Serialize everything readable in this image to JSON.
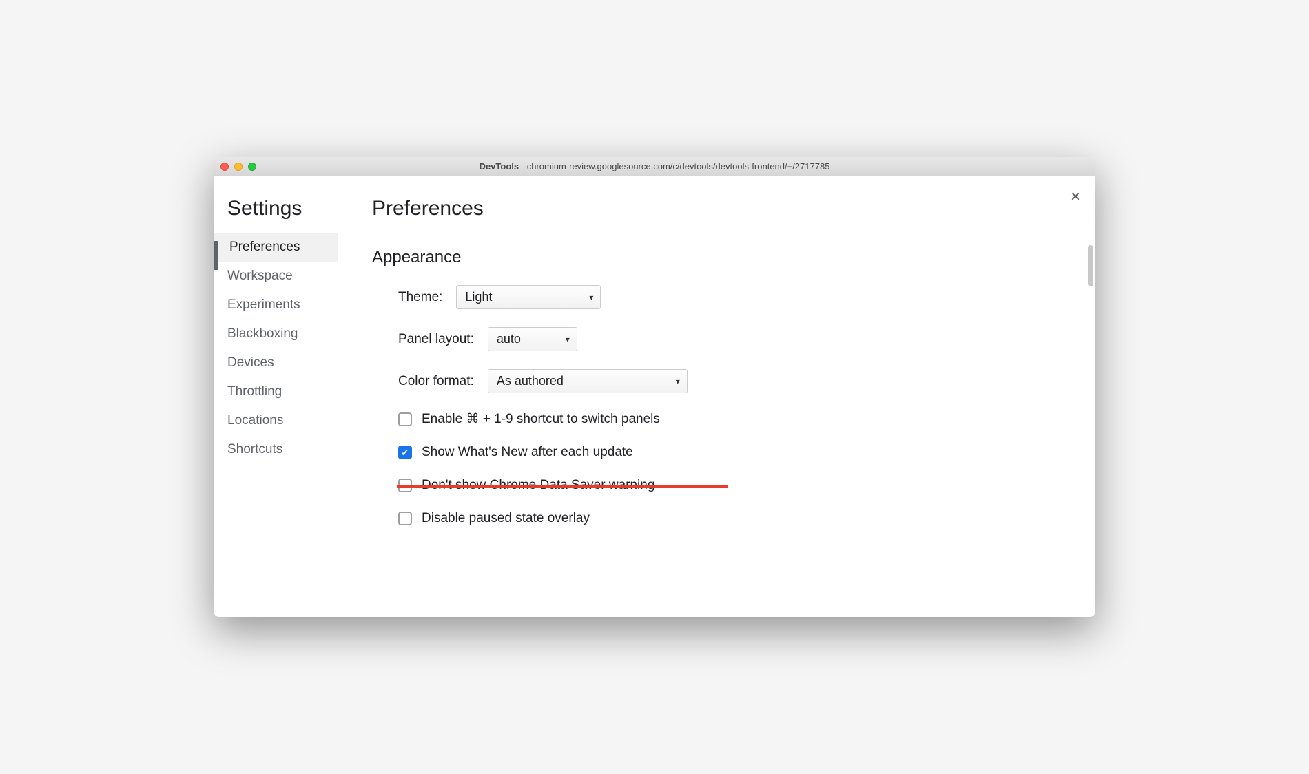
{
  "window": {
    "title_prefix": "DevTools",
    "title_url": "chromium-review.googlesource.com/c/devtools/devtools-frontend/+/2717785"
  },
  "close_label": "×",
  "sidebar": {
    "title": "Settings",
    "items": [
      {
        "label": "Preferences",
        "active": true
      },
      {
        "label": "Workspace",
        "active": false
      },
      {
        "label": "Experiments",
        "active": false
      },
      {
        "label": "Blackboxing",
        "active": false
      },
      {
        "label": "Devices",
        "active": false
      },
      {
        "label": "Throttling",
        "active": false
      },
      {
        "label": "Locations",
        "active": false
      },
      {
        "label": "Shortcuts",
        "active": false
      }
    ]
  },
  "main": {
    "title": "Preferences",
    "section": "Appearance",
    "theme": {
      "label": "Theme:",
      "value": "Light"
    },
    "panel_layout": {
      "label": "Panel layout:",
      "value": "auto"
    },
    "color_format": {
      "label": "Color format:",
      "value": "As authored"
    },
    "checkboxes": [
      {
        "label": "Enable ⌘ + 1-9 shortcut to switch panels",
        "checked": false,
        "struck": false
      },
      {
        "label": "Show What's New after each update",
        "checked": true,
        "struck": false
      },
      {
        "label": "Don't show Chrome Data Saver warning",
        "checked": false,
        "struck": true
      },
      {
        "label": "Disable paused state overlay",
        "checked": false,
        "struck": false
      }
    ]
  }
}
